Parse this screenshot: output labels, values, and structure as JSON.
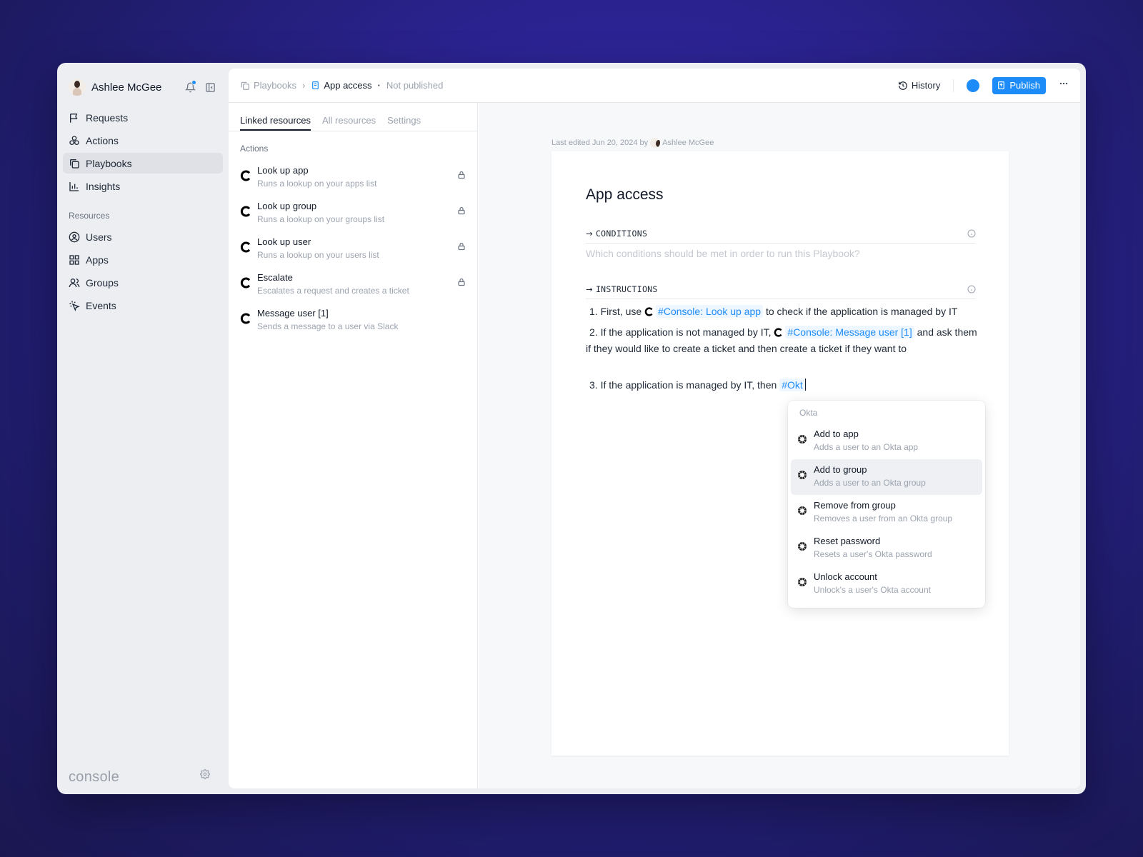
{
  "user": {
    "name": "Ashlee McGee"
  },
  "nav": [
    {
      "label": "Requests",
      "icon": "flag-icon"
    },
    {
      "label": "Actions",
      "icon": "actions-icon"
    },
    {
      "label": "Playbooks",
      "icon": "playbooks-icon",
      "active": true
    },
    {
      "label": "Insights",
      "icon": "chart-icon"
    }
  ],
  "resources_label": "Resources",
  "resources_nav": [
    {
      "label": "Users",
      "icon": "user-circle-icon"
    },
    {
      "label": "Apps",
      "icon": "grid-icon"
    },
    {
      "label": "Groups",
      "icon": "users-icon"
    },
    {
      "label": "Events",
      "icon": "cursor-click-icon"
    }
  ],
  "brand": "console",
  "breadcrumb": {
    "parent": "Playbooks",
    "current": "App access",
    "status": "Not published"
  },
  "toolbar": {
    "history": "History",
    "publish": "Publish",
    "accent": "#1d8cf8"
  },
  "tabs": [
    "Linked resources",
    "All resources",
    "Settings"
  ],
  "actions_section": "Actions",
  "actions": [
    {
      "title": "Look up app",
      "desc": "Runs a lookup on your apps list",
      "locked": true
    },
    {
      "title": "Look up group",
      "desc": "Runs a lookup on your groups list",
      "locked": true
    },
    {
      "title": "Look up user",
      "desc": "Runs a lookup on your users list",
      "locked": true
    },
    {
      "title": "Escalate",
      "desc": "Escalates a request and creates a ticket",
      "locked": true
    },
    {
      "title": "Message user [1]",
      "desc": "Sends a message to a user via Slack",
      "locked": false
    }
  ],
  "doc": {
    "last_edited_prefix": "Last edited Jun 20, 2024 by",
    "last_edited_by": "Ashlee McGee",
    "title": "App access",
    "conditions_label": "CONDITIONS",
    "conditions_placeholder": "Which conditions should be met in order to run this Playbook?",
    "instructions_label": "INSTRUCTIONS",
    "step1_num": "1.",
    "step1_pre": "First, use",
    "step1_mention": "#Console: Look up app",
    "step1_post": "to check if the application is managed by IT",
    "step2_num": "2.",
    "step2_pre": "If the application is not managed by IT,",
    "step2_mention": "#Console: Message user [1]",
    "step2_post": "and ask them if they would like to create a ticket and then create a ticket if they want to",
    "step3_num": "3.",
    "step3_pre": "If the application is managed by IT, then",
    "step3_mention": "#Okt"
  },
  "dropdown": {
    "heading": "Okta",
    "items": [
      {
        "title": "Add to app",
        "desc": "Adds a user to an Okta app"
      },
      {
        "title": "Add to group",
        "desc": "Adds a user to an Okta group",
        "highlighted": true
      },
      {
        "title": "Remove from group",
        "desc": "Removes a user from an Okta group"
      },
      {
        "title": "Reset password",
        "desc": "Resets a user's Okta password"
      },
      {
        "title": "Unlock account",
        "desc": "Unlock's a user's Okta account"
      }
    ]
  }
}
